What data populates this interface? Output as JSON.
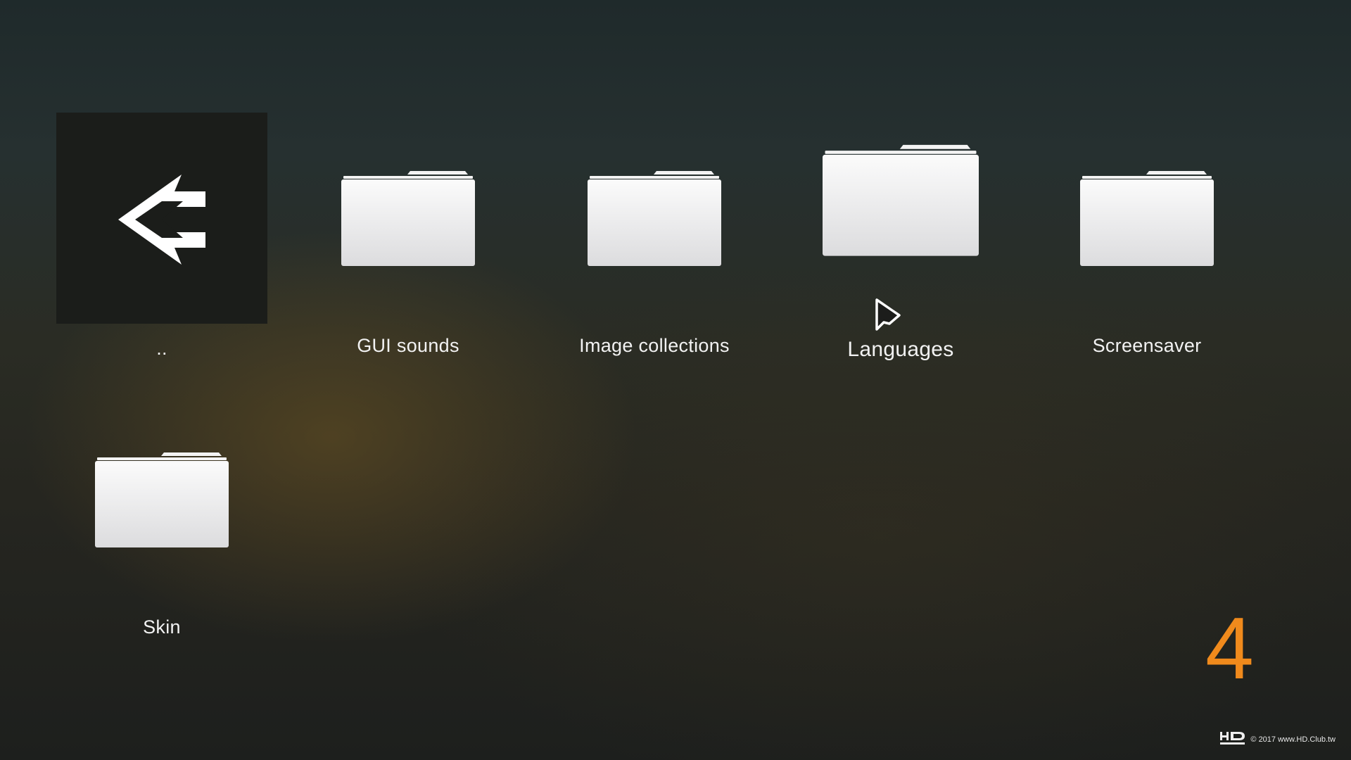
{
  "items": [
    {
      "label": "..",
      "icon": "back-arrow-icon"
    },
    {
      "label": "GUI sounds",
      "icon": "folder-icon"
    },
    {
      "label": "Image collections",
      "icon": "folder-icon"
    },
    {
      "label": "Languages",
      "icon": "folder-icon",
      "focused": true
    },
    {
      "label": "Screensaver",
      "icon": "folder-icon"
    },
    {
      "label": "Skin",
      "icon": "folder-icon"
    }
  ],
  "counter": "4",
  "watermark": {
    "logo": "HD CLUB",
    "text": "© 2017 www.HD.Club.tw"
  },
  "colors": {
    "accent": "#f08a1c",
    "label": "#f2f2f2",
    "folder": "#eeeeef"
  }
}
